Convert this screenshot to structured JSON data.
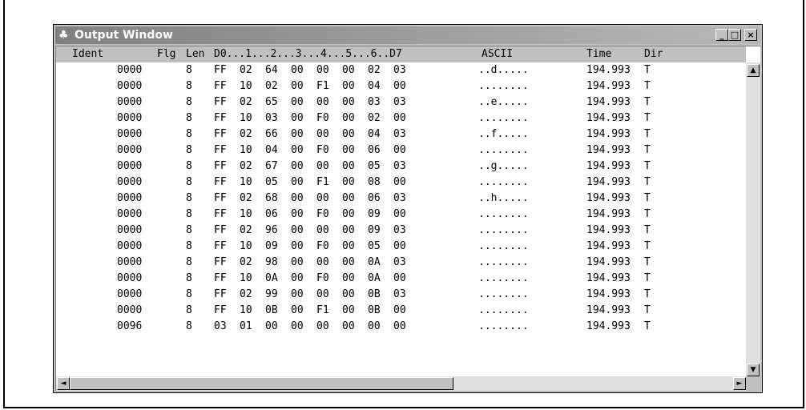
{
  "window": {
    "title": "Output Window",
    "icon": "app-icon",
    "buttons": {
      "minimize": "_",
      "maximize": "□",
      "close": "×"
    }
  },
  "columns": {
    "ident": "Ident",
    "flg": "Flg",
    "len": "Len",
    "data": "D0...1...2...3...4...5...6..D7",
    "ascii": "ASCII",
    "time": "Time",
    "dir": "Dir"
  },
  "rows": [
    {
      "ident": "0000",
      "len": "8",
      "bytes": [
        "FF",
        "02",
        "64",
        "00",
        "00",
        "00",
        "02",
        "03"
      ],
      "ascii": "..d.....",
      "time": "194.993",
      "dir": "T"
    },
    {
      "ident": "0000",
      "len": "8",
      "bytes": [
        "FF",
        "10",
        "02",
        "00",
        "F1",
        "00",
        "04",
        "00"
      ],
      "ascii": "........",
      "time": "194.993",
      "dir": "T"
    },
    {
      "ident": "0000",
      "len": "8",
      "bytes": [
        "FF",
        "02",
        "65",
        "00",
        "00",
        "00",
        "03",
        "03"
      ],
      "ascii": "..e.....",
      "time": "194.993",
      "dir": "T"
    },
    {
      "ident": "0000",
      "len": "8",
      "bytes": [
        "FF",
        "10",
        "03",
        "00",
        "F0",
        "00",
        "02",
        "00"
      ],
      "ascii": "........",
      "time": "194.993",
      "dir": "T"
    },
    {
      "ident": "0000",
      "len": "8",
      "bytes": [
        "FF",
        "02",
        "66",
        "00",
        "00",
        "00",
        "04",
        "03"
      ],
      "ascii": "..f.....",
      "time": "194.993",
      "dir": "T"
    },
    {
      "ident": "0000",
      "len": "8",
      "bytes": [
        "FF",
        "10",
        "04",
        "00",
        "F0",
        "00",
        "06",
        "00"
      ],
      "ascii": "........",
      "time": "194.993",
      "dir": "T"
    },
    {
      "ident": "0000",
      "len": "8",
      "bytes": [
        "FF",
        "02",
        "67",
        "00",
        "00",
        "00",
        "05",
        "03"
      ],
      "ascii": "..g.....",
      "time": "194.993",
      "dir": "T"
    },
    {
      "ident": "0000",
      "len": "8",
      "bytes": [
        "FF",
        "10",
        "05",
        "00",
        "F1",
        "00",
        "08",
        "00"
      ],
      "ascii": "........",
      "time": "194.993",
      "dir": "T"
    },
    {
      "ident": "0000",
      "len": "8",
      "bytes": [
        "FF",
        "02",
        "68",
        "00",
        "00",
        "00",
        "06",
        "03"
      ],
      "ascii": "..h.....",
      "time": "194.993",
      "dir": "T"
    },
    {
      "ident": "0000",
      "len": "8",
      "bytes": [
        "FF",
        "10",
        "06",
        "00",
        "F0",
        "00",
        "09",
        "00"
      ],
      "ascii": "........",
      "time": "194.993",
      "dir": "T"
    },
    {
      "ident": "0000",
      "len": "8",
      "bytes": [
        "FF",
        "02",
        "96",
        "00",
        "00",
        "00",
        "09",
        "03"
      ],
      "ascii": "........",
      "time": "194.993",
      "dir": "T"
    },
    {
      "ident": "0000",
      "len": "8",
      "bytes": [
        "FF",
        "10",
        "09",
        "00",
        "F0",
        "00",
        "05",
        "00"
      ],
      "ascii": "........",
      "time": "194.993",
      "dir": "T"
    },
    {
      "ident": "0000",
      "len": "8",
      "bytes": [
        "FF",
        "02",
        "98",
        "00",
        "00",
        "00",
        "0A",
        "03"
      ],
      "ascii": "........",
      "time": "194.993",
      "dir": "T"
    },
    {
      "ident": "0000",
      "len": "8",
      "bytes": [
        "FF",
        "10",
        "0A",
        "00",
        "F0",
        "00",
        "0A",
        "00"
      ],
      "ascii": "........",
      "time": "194.993",
      "dir": "T"
    },
    {
      "ident": "0000",
      "len": "8",
      "bytes": [
        "FF",
        "02",
        "99",
        "00",
        "00",
        "00",
        "0B",
        "03"
      ],
      "ascii": "........",
      "time": "194.993",
      "dir": "T"
    },
    {
      "ident": "0000",
      "len": "8",
      "bytes": [
        "FF",
        "10",
        "0B",
        "00",
        "F1",
        "00",
        "0B",
        "00"
      ],
      "ascii": "........",
      "time": "194.993",
      "dir": "T"
    },
    {
      "ident": "0096",
      "len": "8",
      "bytes": [
        "03",
        "01",
        "00",
        "00",
        "00",
        "00",
        "00",
        "00"
      ],
      "ascii": "........",
      "time": "194.993",
      "dir": "T"
    }
  ],
  "scrollbars": {
    "up": "▲",
    "down": "▼",
    "left": "◄",
    "right": "►"
  },
  "colors": {
    "titlebar_start": "#808080",
    "titlebar_end": "#b8b8b8",
    "chrome": "#c0c0c0"
  }
}
